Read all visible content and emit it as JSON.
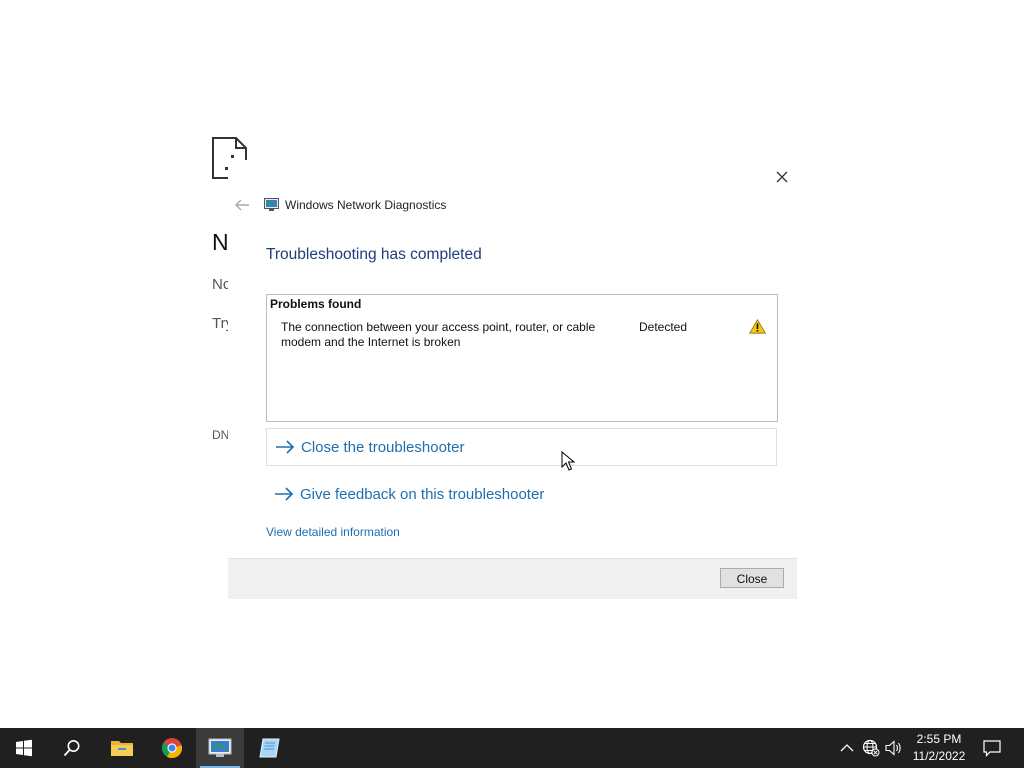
{
  "background_page": {
    "heading_fragment": "N",
    "line1_fragment": "Nc",
    "line2_fragment": "Try",
    "line3_fragment": "DN"
  },
  "dialog": {
    "app_title": "Windows Network Diagnostics",
    "headline": "Troubleshooting has completed",
    "problems": {
      "title": "Problems found",
      "items": [
        {
          "description": "The connection between your access point, router, or cable modem and the Internet is broken",
          "status": "Detected",
          "icon": "warning-icon"
        }
      ]
    },
    "actions": {
      "close_troubleshooter": "Close the troubleshooter",
      "give_feedback": "Give feedback on this troubleshooter"
    },
    "details_link": "View detailed information",
    "close_button": "Close"
  },
  "taskbar": {
    "apps": [
      "start-icon",
      "search-icon",
      "file-explorer-icon",
      "chrome-icon",
      "network-diagnostics-icon",
      "notepad-icon"
    ],
    "active_app": "network-diagnostics-icon",
    "clock": {
      "time": "2:55 PM",
      "date": "11/2/2022"
    }
  },
  "colors": {
    "headline": "#1f3d7a",
    "link": "#1e6fb0",
    "taskbar": "#202020",
    "warning": "#f2c811"
  }
}
